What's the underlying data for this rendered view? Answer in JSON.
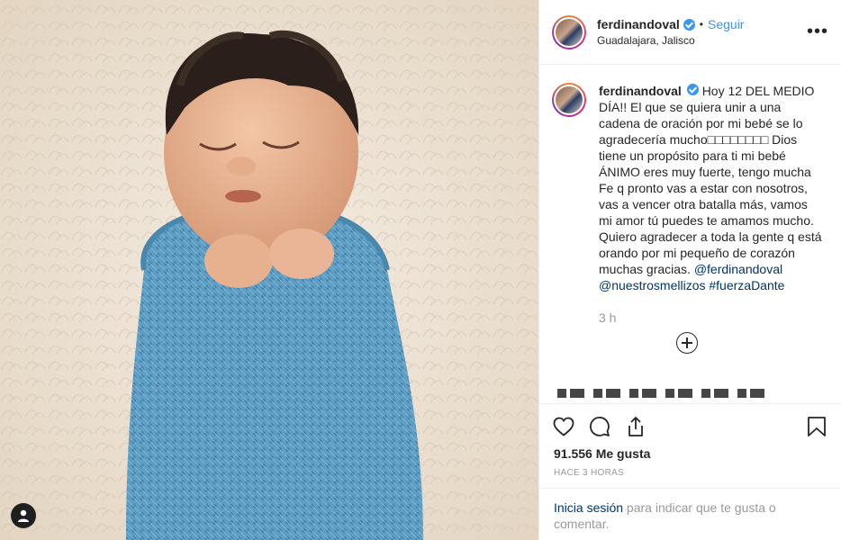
{
  "post": {
    "username": "ferdinandoval",
    "follow_label": "Seguir",
    "separator": "•",
    "location": "Guadalajara, Jalisco",
    "more_glyph": "•••"
  },
  "caption": {
    "username": "ferdinandoval",
    "text": "Hoy 12 DEL MEDIO DÍA!! El que se quiera unir a una cadena de oración por mi bebé se lo agradecería mucho□□□□□□□□ Dios tiene un propósito para ti mi bebé ÁNIMO eres muy fuerte, tengo mucha Fe q pronto vas a estar con nosotros, vas a vencer otra batalla más, vamos mi amor tú puedes te amamos mucho. Quiero agradecer a toda la gente q está orando por mi pequeño de corazón muchas gracias.",
    "mention1": "@ferdinandoval",
    "mention2": "@nuestrosmellizos",
    "hashtag": "#fuerzaDante",
    "time": "3 h"
  },
  "actions": {
    "icons": [
      "heart-icon",
      "comment-icon",
      "share-icon",
      "bookmark-icon"
    ]
  },
  "likes": "91.556 Me gusta",
  "posted_ago": "HACE 3 HORAS",
  "login_prompt": {
    "link": "Inicia sesión",
    "rest": " para indicar que te gusta o comentar."
  },
  "colors": {
    "accent": "#3897f0",
    "link": "#003569",
    "muted": "#999999",
    "blanket": "#5f9ec4"
  }
}
